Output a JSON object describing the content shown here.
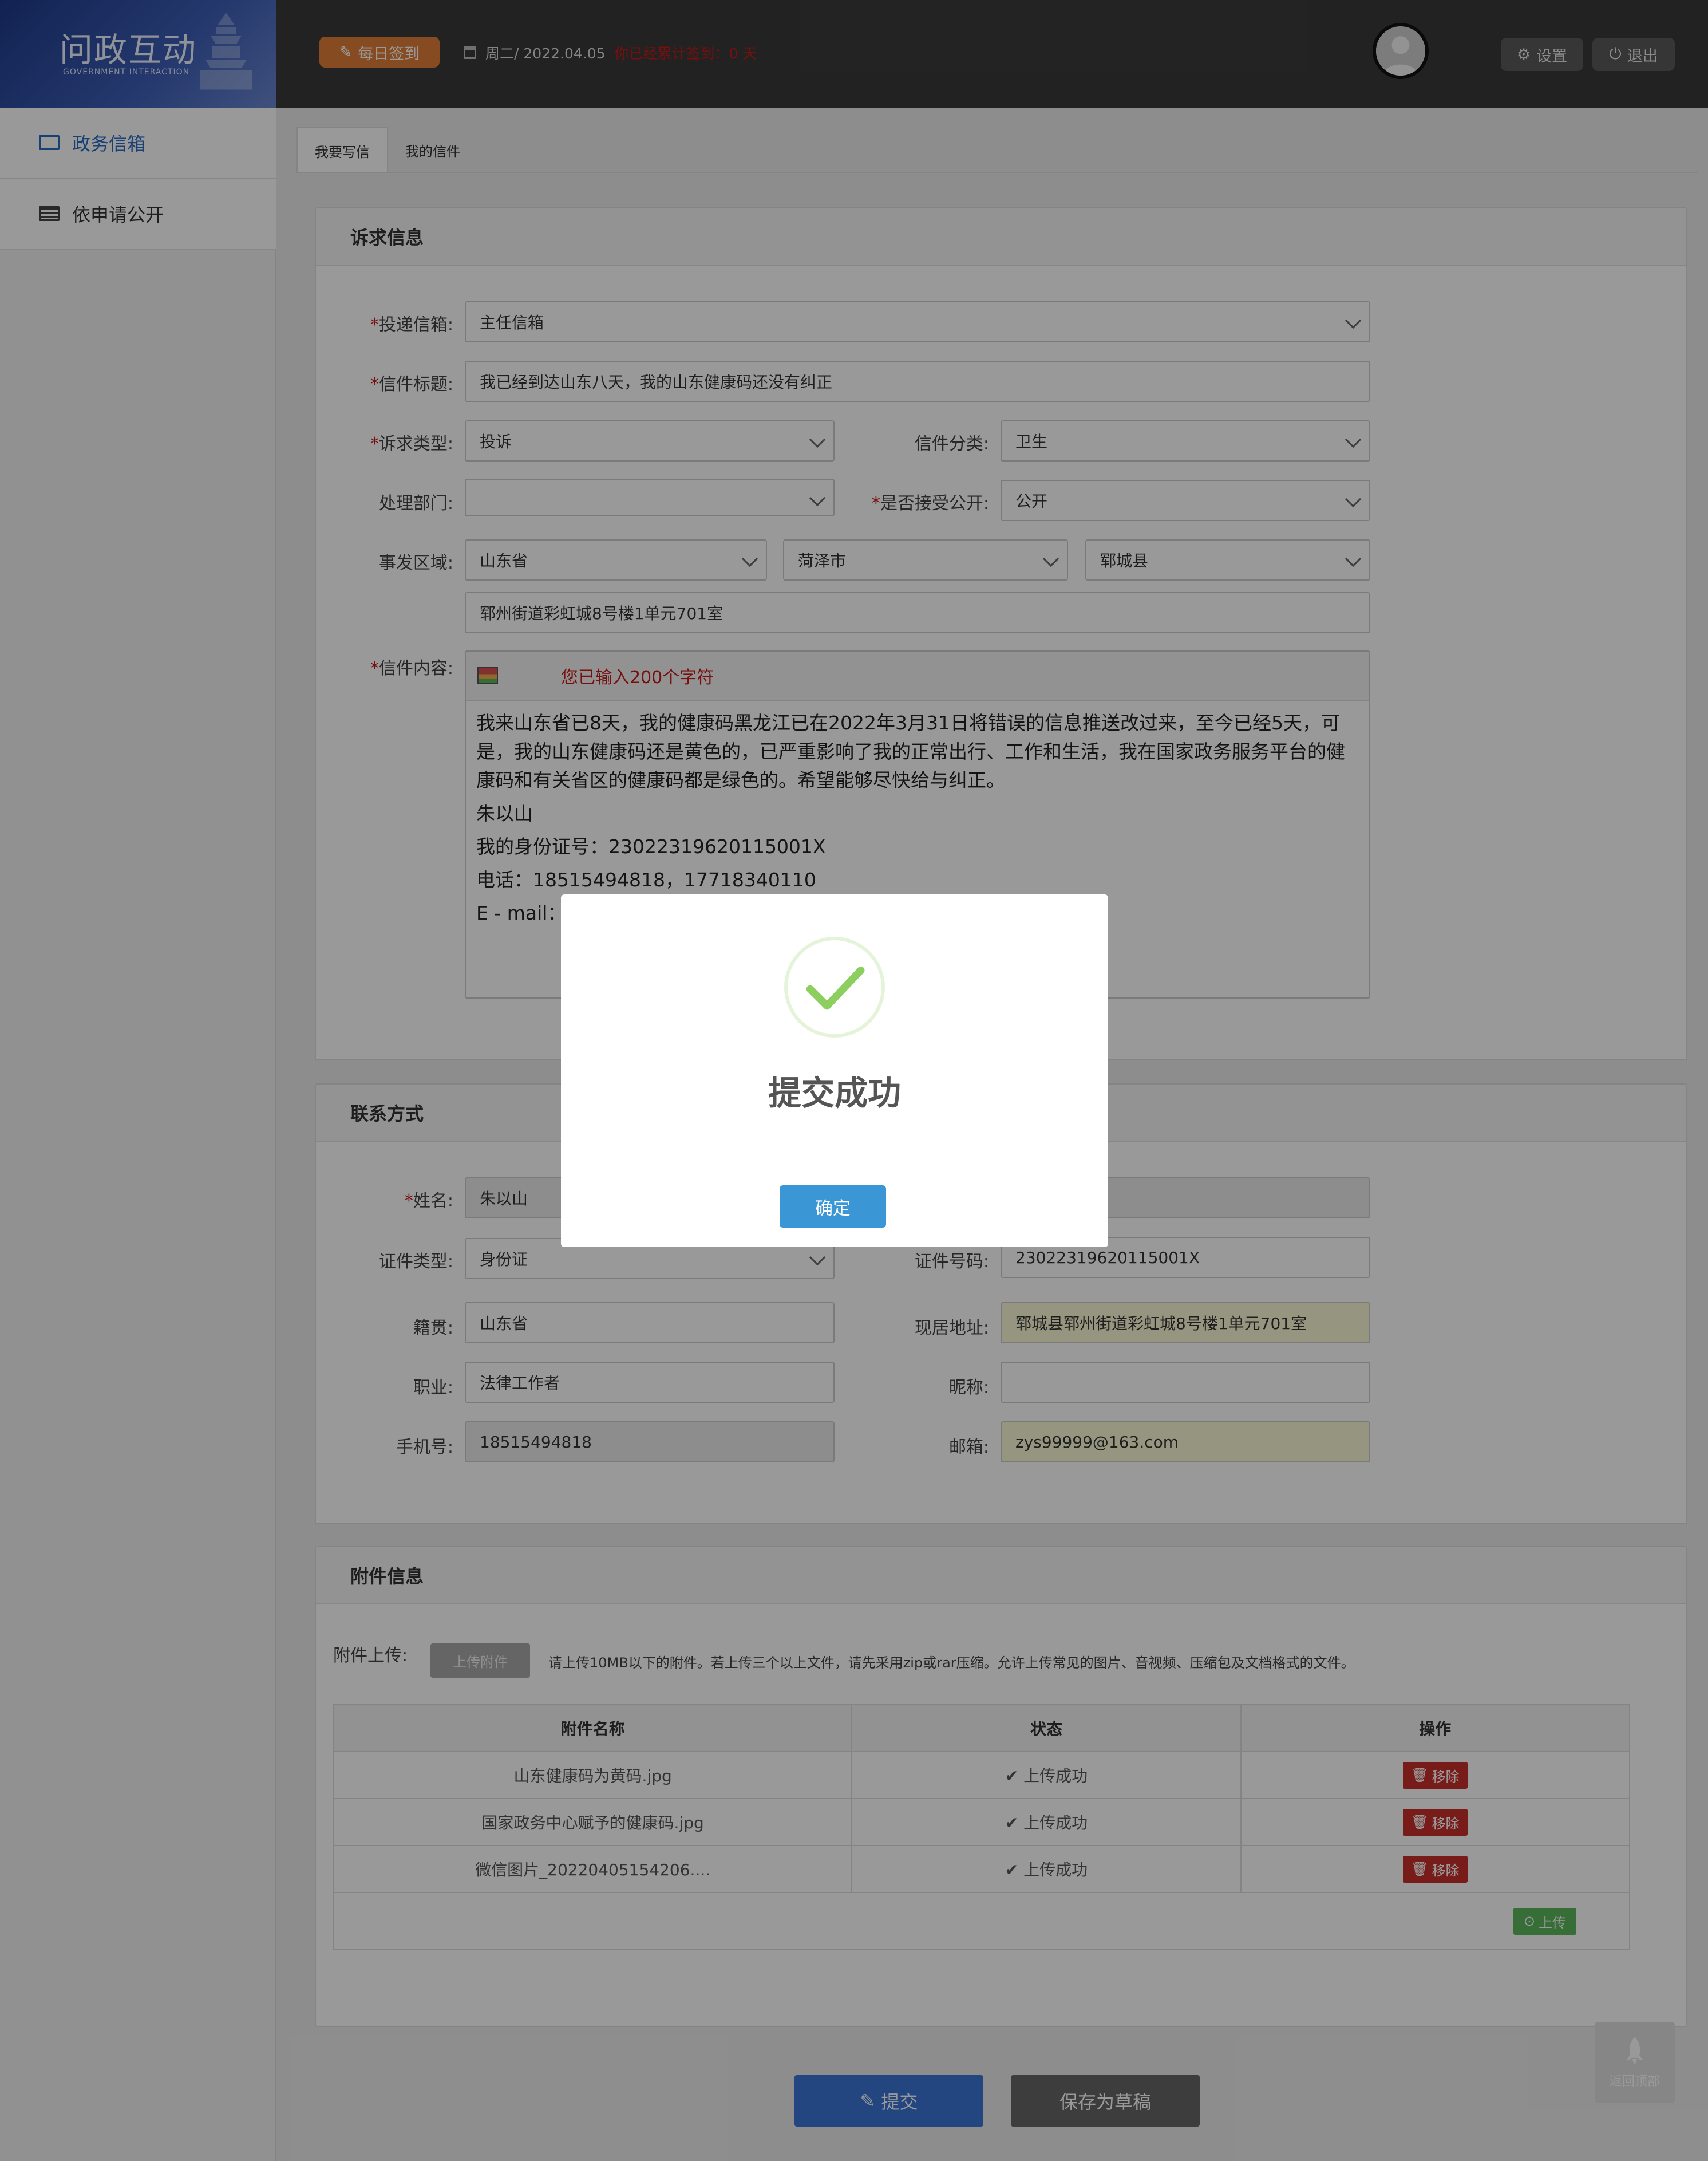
{
  "header": {
    "logo_title": "问政互动",
    "logo_subtitle": "GOVERNMENT INTERACTION",
    "signin_label": "每日签到",
    "date_text": "周二/ 2022.04.05",
    "streak_text": "你已经累计签到：0 天",
    "settings_label": "设置",
    "logout_label": "退出"
  },
  "sidebar": {
    "items": [
      {
        "label": "政务信箱",
        "icon": "envelope-icon",
        "active": true
      },
      {
        "label": "依申请公开",
        "icon": "list-icon",
        "active": false
      }
    ]
  },
  "tabs": [
    {
      "label": "我要写信",
      "active": true
    },
    {
      "label": "我的信件",
      "active": false
    }
  ],
  "request": {
    "section_title": "诉求信息",
    "mailbox_label": "投递信箱:",
    "mailbox_value": "主任信箱",
    "subject_label": "信件标题:",
    "subject_value": "我已经到达山东八天，我的山东健康码还没有纠正",
    "type_label": "诉求类型:",
    "type_value": "投诉",
    "category_label": "信件分类:",
    "category_value": "卫生",
    "dept_label": "处理部门:",
    "dept_value": "",
    "public_label": "是否接受公开:",
    "public_value": "公开",
    "region_label": "事发区域:",
    "province": "山东省",
    "city": "菏泽市",
    "county": "郓城县",
    "address": "郓州街道彩虹城8号楼1单元701室",
    "content_label": "信件内容:",
    "char_count": "您已输入200个字符",
    "content_lines": [
      "我来山东省已8天，我的健康码黑龙江已在2022年3月31日将错误的信息推送改过来，至今已经5天，可是，我的山东健康码还是黄色的，已严重影响了我的正常出行、工作和生活，我在国家政务服务平台的健康码和有关省区的健康码都是绿色的。希望能够尽快给与纠正。",
      "朱以山",
      "我的身份证号：23022319620115001X",
      "电话：18515494818，17718340110",
      "E - mail："
    ]
  },
  "contact": {
    "section_title": "联系方式",
    "name_label": "姓名:",
    "name_value": "朱以山",
    "id_type_label": "证件类型:",
    "id_type_value": "身份证",
    "id_no_label": "证件号码:",
    "id_no_value": "23022319620115001X",
    "origin_label": "籍贯:",
    "origin_value": "山东省",
    "address_label": "现居地址:",
    "address_value": "郓城县郓州街道彩虹城8号楼1单元701室",
    "job_label": "职业:",
    "job_value": "法律工作者",
    "nickname_label": "昵称:",
    "nickname_value": "",
    "phone_label": "手机号:",
    "phone_value": "18515494818",
    "email_label": "邮箱:",
    "email_value": "zys99999@163.com"
  },
  "attachments": {
    "section_title": "附件信息",
    "upload_label": "附件上传:",
    "upload_button": "上传附件",
    "note": "请上传10MB以下的附件。若上传三个以上文件，请先采用zip或rar压缩。允许上传常见的图片、音视频、压缩包及文档格式的文件。",
    "columns": [
      "附件名称",
      "状态",
      "操作"
    ],
    "rows": [
      {
        "name": "山东健康码为黄码.jpg",
        "status": "上传成功",
        "action": "移除"
      },
      {
        "name": "国家政务中心赋予的健康码.jpg",
        "status": "上传成功",
        "action": "移除"
      },
      {
        "name": "微信图片_20220405154206....",
        "status": "上传成功",
        "action": "移除"
      }
    ],
    "upload_row_button": "上传"
  },
  "actions": {
    "submit_label": "提交",
    "draft_label": "保存为草稿",
    "backtop_label": "返回顶部"
  },
  "modal": {
    "title": "提交成功",
    "confirm_label": "确定"
  },
  "colors": {
    "header_bg": "#3a3a3a",
    "accent_blue": "#3b75d6",
    "signin_orange": "#e07d36",
    "danger_red": "#c9302c",
    "success_green": "#8ccf5e"
  }
}
